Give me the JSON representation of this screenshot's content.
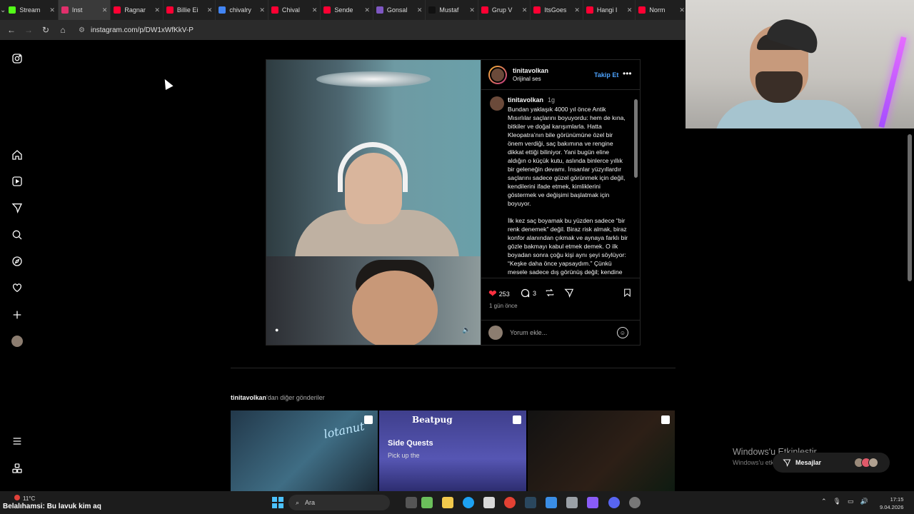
{
  "browser": {
    "tabs": [
      {
        "title": "Stream",
        "color": "#53fc18"
      },
      {
        "title": "Inst",
        "color": "#e1306c",
        "active": true
      },
      {
        "title": "Ragnar",
        "color": "#ff0033"
      },
      {
        "title": "Billie Ei",
        "color": "#ff0033"
      },
      {
        "title": "chivalry",
        "color": "#4285f4"
      },
      {
        "title": "Chival",
        "color": "#ff0033"
      },
      {
        "title": "Sende",
        "color": "#ff0033"
      },
      {
        "title": "Gonsal",
        "color": "#7e57c2"
      },
      {
        "title": "Mustaf",
        "color": "#111111"
      },
      {
        "title": "Grup V",
        "color": "#ff0033"
      },
      {
        "title": "ItsGoes",
        "color": "#ff0033"
      },
      {
        "title": "Hangi I",
        "color": "#ff0033"
      },
      {
        "title": "Norm",
        "color": "#ff0033"
      }
    ],
    "url": "instagram.com/p/DW1xWfKkV-P"
  },
  "post": {
    "username": "tinitavolkan",
    "audio": "Orijinal ses",
    "follow_label": "Takip Et",
    "caption_time": "1g",
    "caption_paragraphs": [
      "Bundan yaklaşık 4000 yıl önce Antik Mısırlılar saçlarını boyuyordu: hem de kına, bitkiler ve doğal karışımlarla. Hatta Kleopatra’nın bile görünümüne özel bir önem verdiği, saç bakımına ve rengine dikkat ettiği biliniyor. Yani bugün eline aldığın o küçük kutu, aslında binlerce yıllık bir geleneğin devamı. İnsanlar yüzyıllardır saçlarını sadece güzel görünmek için değil, kendilerini ifade etmek, kimliklerini göstermek ve değişimi başlatmak için boyuyor.",
      "İlk kez saç boyamak bu yüzden sadece “bir renk denemek” değil. Biraz risk almak, biraz konfor alanından çıkmak ve aynaya farklı bir gözle bakmayı kabul etmek demek. O ilk boyadan sonra çoğu kişi aynı şeyi söylüyor: “Keşke daha önce yapsaydım.” Çünkü mesele sadece dış görünüş değil; kendine"
    ],
    "likes": "253",
    "comments": "3",
    "posted_ago": "1 gün önce",
    "comment_placeholder": "Yorum ekle..."
  },
  "more_posts": {
    "owner": "tinitavolkan",
    "suffix": "'dan diğer gönderiler",
    "thumb2_brand": "Beatpug",
    "thumb2_title": "Side Quests",
    "thumb2_sub": "Pick up the",
    "thumb1_neon": "lotanut"
  },
  "overlay": {
    "activate_title": "Windows'u Etkinleştir",
    "activate_sub": "Windows'u etkinleştirmek için Ayarlar",
    "messages_label": "Mesajlar"
  },
  "taskbar": {
    "weather": "11°C",
    "now_playing": "Belalıhamsi: Bu lavuk kim aq",
    "search_placeholder": "Ara",
    "time": "17:15",
    "date": "9.04.2026"
  },
  "colors": {
    "ig_blue": "#4da3ff",
    "like_red": "#ff3040",
    "windows_accent": "#4cc2ff"
  }
}
